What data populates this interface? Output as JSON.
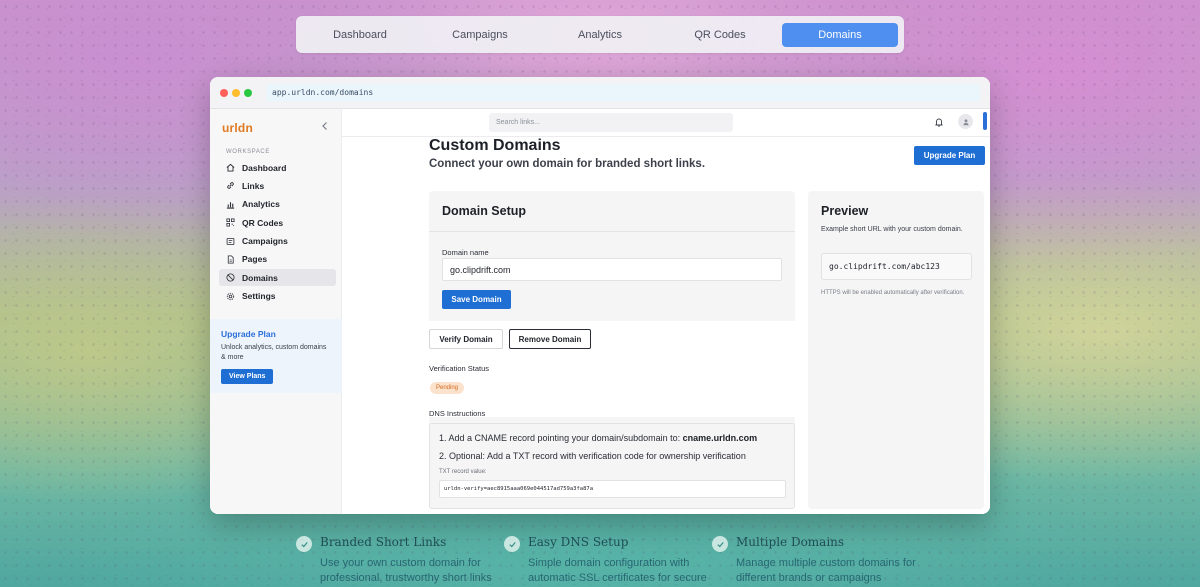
{
  "top_nav": {
    "tabs": [
      {
        "label": "Dashboard",
        "active": false
      },
      {
        "label": "Campaigns",
        "active": false
      },
      {
        "label": "Analytics",
        "active": false
      },
      {
        "label": "QR Codes",
        "active": false
      },
      {
        "label": "Domains",
        "active": true
      }
    ]
  },
  "browser": {
    "url": "app.urldn.com/domains"
  },
  "sidebar": {
    "logo": "urldn",
    "workspace_label": "WORKSPACE",
    "items": [
      {
        "label": "Dashboard",
        "icon": "home-icon",
        "active": false
      },
      {
        "label": "Links",
        "icon": "link-icon",
        "active": false
      },
      {
        "label": "Analytics",
        "icon": "bar-chart-icon",
        "active": false
      },
      {
        "label": "QR Codes",
        "icon": "qr-code-icon",
        "active": false
      },
      {
        "label": "Campaigns",
        "icon": "campaign-icon",
        "active": false
      },
      {
        "label": "Pages",
        "icon": "page-icon",
        "active": false
      },
      {
        "label": "Domains",
        "icon": "globe-icon",
        "active": true
      },
      {
        "label": "Settings",
        "icon": "gear-icon",
        "active": false
      }
    ],
    "upgrade": {
      "title": "Upgrade Plan",
      "description": "Unlock analytics, custom domains & more",
      "button": "View Plans"
    }
  },
  "header": {
    "search_placeholder": "Search links..."
  },
  "page": {
    "title": "Custom Domains",
    "subtitle": "Connect your own domain for branded short links.",
    "upgrade_button": "Upgrade Plan"
  },
  "setup": {
    "title": "Domain Setup",
    "domain_label": "Domain name",
    "domain_value": "go.clipdrift.com",
    "save_button": "Save Domain",
    "verify_button": "Verify Domain",
    "remove_button": "Remove Domain",
    "verification_label": "Verification Status",
    "verification_status": "Pending",
    "dns_label": "DNS Instructions",
    "dns_step1_prefix": "1. Add a CNAME record pointing your domain/subdomain to: ",
    "dns_step1_target": "cname.urldn.com",
    "dns_step2": "2. Optional: Add a TXT record with verification code for ownership verification",
    "txt_label": "TXT record value:",
    "txt_value": "urldn-verify=aec8915aaa069e044517ad759a3fa87a"
  },
  "preview": {
    "title": "Preview",
    "description": "Example short URL with your custom domain.",
    "url": "go.clipdrift.com/abc123",
    "note": "HTTPS will be enabled automatically after verification."
  },
  "features": [
    {
      "title": "Branded Short Links",
      "description": "Use your own custom domain for professional, trustworthy short links"
    },
    {
      "title": "Easy DNS Setup",
      "description": "Simple domain configuration with automatic SSL certificates for secure"
    },
    {
      "title": "Multiple Domains",
      "description": "Manage multiple custom domains for different brands or campaigns"
    }
  ],
  "colors": {
    "accent": "#1f6ed4",
    "nav_active": "#4f8ff0",
    "logo": "#e07a22",
    "pending_bg": "#fbe2cd",
    "pending_text": "#d06a1f"
  }
}
